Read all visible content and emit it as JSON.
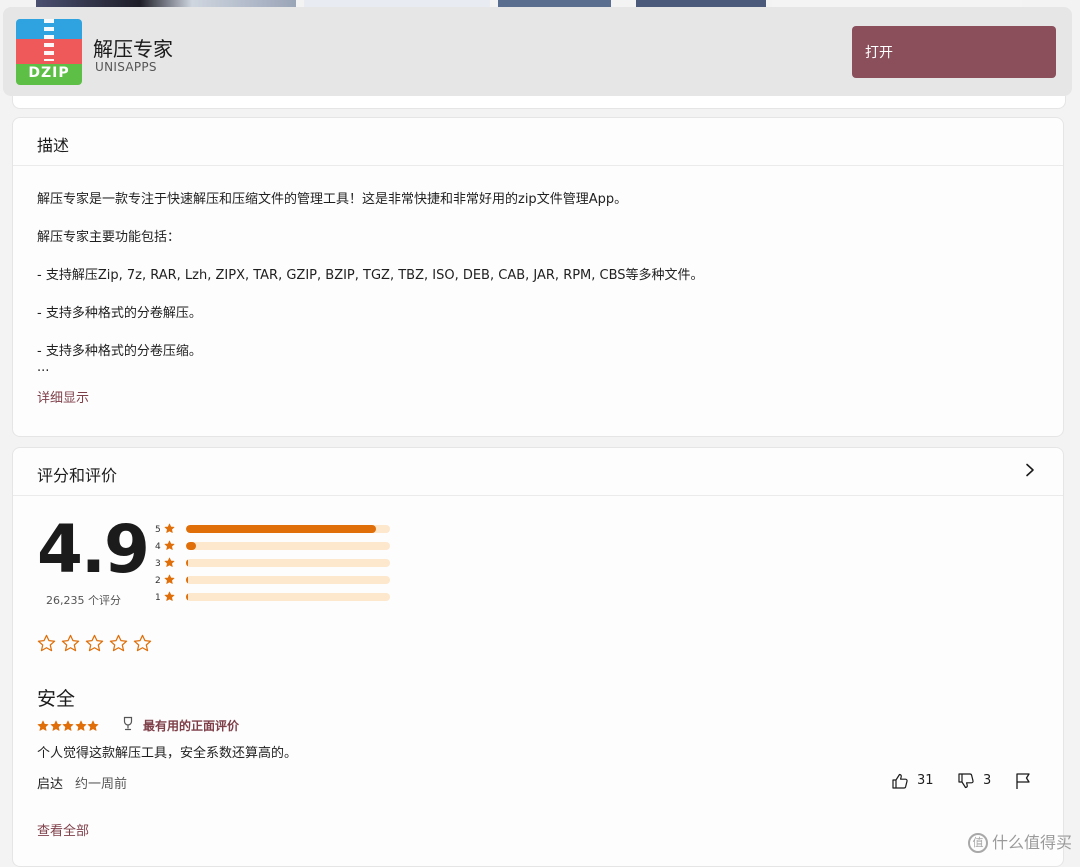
{
  "app": {
    "name": "解压专家",
    "publisher": "UNISAPPS",
    "icon_label": "DZIP",
    "open_button": "打开"
  },
  "description": {
    "heading": "描述",
    "lines": [
      "解压专家是一款专注于快速解压和压缩文件的管理工具！这是非常快捷和非常好用的zip文件管理App。",
      "解压专家主要功能包括：",
      "- 支持解压Zip, 7z, RAR, Lzh, ZIPX, TAR, GZIP, BZIP, TGZ, TBZ, ISO, DEB, CAB, JAR, RPM, CBS等多种文件。",
      "- 支持多种格式的分卷解压。",
      "- 支持多种格式的分卷压缩。"
    ],
    "ellipsis": "...",
    "show_more": "详细显示"
  },
  "ratings": {
    "heading": "评分和评价",
    "average": "4.9",
    "count_text": "26,235 个评分",
    "distribution": [
      {
        "stars": "5",
        "fraction": 0.93
      },
      {
        "stars": "4",
        "fraction": 0.05
      },
      {
        "stars": "3",
        "fraction": 0.01
      },
      {
        "stars": "2",
        "fraction": 0.005
      },
      {
        "stars": "1",
        "fraction": 0.01
      }
    ],
    "user_rating_stars": 5
  },
  "review": {
    "title": "安全",
    "stars": 5,
    "badge": "最有用的正面评价",
    "body": "个人觉得这款解压工具，安全系数还算高的。",
    "author": "启达",
    "time": "约一周前",
    "likes": "31",
    "dislikes": "3"
  },
  "see_all": "查看全部",
  "watermark": "什么值得买",
  "colors": {
    "accent": "#8a4f5a",
    "link": "#7f3f49",
    "star": "#e06e09",
    "bar_track": "#fde7cd"
  }
}
